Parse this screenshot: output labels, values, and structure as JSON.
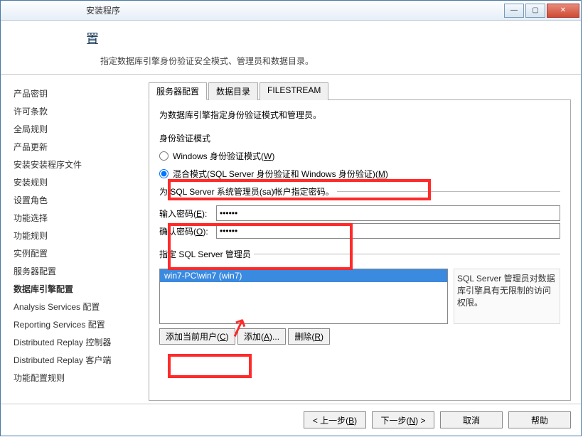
{
  "window": {
    "title": "安装程序"
  },
  "header": {
    "title": "置",
    "subtitle": "指定数据库引擎身份验证安全模式、管理员和数据目录。"
  },
  "sidebar": {
    "items": [
      {
        "label": "产品密钥",
        "bold": false
      },
      {
        "label": "许可条款",
        "bold": false
      },
      {
        "label": "全局规则",
        "bold": false
      },
      {
        "label": "产品更新",
        "bold": false
      },
      {
        "label": "安装安装程序文件",
        "bold": false
      },
      {
        "label": "安装规则",
        "bold": false
      },
      {
        "label": "设置角色",
        "bold": false
      },
      {
        "label": "功能选择",
        "bold": false
      },
      {
        "label": "功能规则",
        "bold": false
      },
      {
        "label": "实例配置",
        "bold": false
      },
      {
        "label": "服务器配置",
        "bold": false
      },
      {
        "label": "数据库引擎配置",
        "bold": true
      },
      {
        "label": "Analysis Services 配置",
        "bold": false
      },
      {
        "label": "Reporting Services 配置",
        "bold": false
      },
      {
        "label": "Distributed Replay 控制器",
        "bold": false
      },
      {
        "label": "Distributed Replay 客户端",
        "bold": false
      },
      {
        "label": "功能配置规则",
        "bold": false
      }
    ]
  },
  "tabs": [
    {
      "label": "服务器配置",
      "active": true
    },
    {
      "label": "数据目录",
      "active": false
    },
    {
      "label": "FILESTREAM",
      "active": false
    }
  ],
  "panel": {
    "desc": "为数据库引擎指定身份验证模式和管理员。",
    "auth_mode_label": "身份验证模式",
    "radio_windows": "Windows 身份验证模式(",
    "radio_windows_key": "W",
    "radio_mixed": "混合模式(SQL Server 身份验证和 Windows 身份验证)(",
    "radio_mixed_key": "M",
    "sa_group": "为 SQL Server 系统管理员(sa)帐户指定密码。",
    "pw_enter_label": "输入密码(",
    "pw_enter_key": "E",
    "pw_confirm_label": "确认密码(",
    "pw_confirm_key": "O",
    "pw_value": "●●●●●●",
    "admins_label": "指定 SQL Server 管理员",
    "admin_selected": "win7-PC\\win7 (win7)",
    "admin_note": "SQL Server 管理员对数据库引擎具有无限制的访问权限。",
    "btn_add_current": "添加当前用户(",
    "btn_add_current_key": "C",
    "btn_add": "添加(",
    "btn_add_key": "A",
    "btn_remove": "删除(",
    "btn_remove_key": "R"
  },
  "footer": {
    "back": "< 上一步(",
    "back_key": "B",
    "next": "下一步(",
    "next_key": "N",
    "next_suffix": ") >",
    "cancel": "取消",
    "help": "帮助"
  }
}
